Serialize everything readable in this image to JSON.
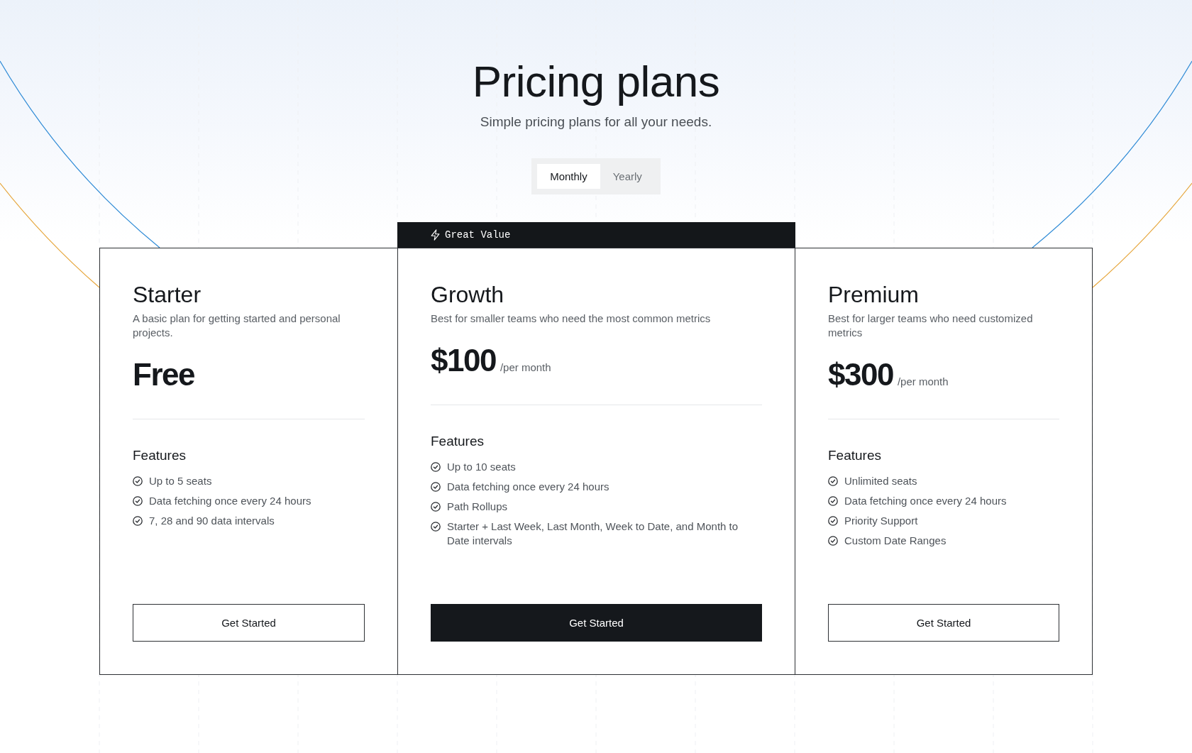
{
  "header": {
    "title": "Pricing plans",
    "subtitle": "Simple pricing plans for all your needs."
  },
  "billing_toggle": [
    {
      "label": "Monthly",
      "selected": true
    },
    {
      "label": "Yearly",
      "selected": false
    }
  ],
  "plans": [
    {
      "name": "Starter",
      "featured": false,
      "description": "A basic plan for getting started and personal projects.",
      "price": "Free",
      "features_heading": "Features",
      "features": [
        "Up to 5 seats",
        "Data fetching once every 24 hours",
        "7, 28 and 90 data intervals"
      ],
      "button": "Get Started"
    },
    {
      "name": "Growth",
      "featured": true,
      "badge": "Great Value",
      "description": "Best for smaller teams who need the most common metrics",
      "price": "$100",
      "period": "/per month",
      "features_heading": "Features",
      "features": [
        "Up to 10 seats",
        "Data fetching once every 24 hours",
        "Path Rollups",
        "Starter + Last Week, Last Month, Week to Date, and Month to Date intervals"
      ],
      "button": "Get Started"
    },
    {
      "name": "Premium",
      "featured": false,
      "description": "Best for larger teams who need customized metrics",
      "price": "$300",
      "period": "/per month",
      "features_heading": "Features",
      "features": [
        "Unlimited seats",
        "Data fetching once every 24 hours",
        "Priority Support",
        "Custom Date Ranges"
      ],
      "button": "Get Started"
    }
  ]
}
